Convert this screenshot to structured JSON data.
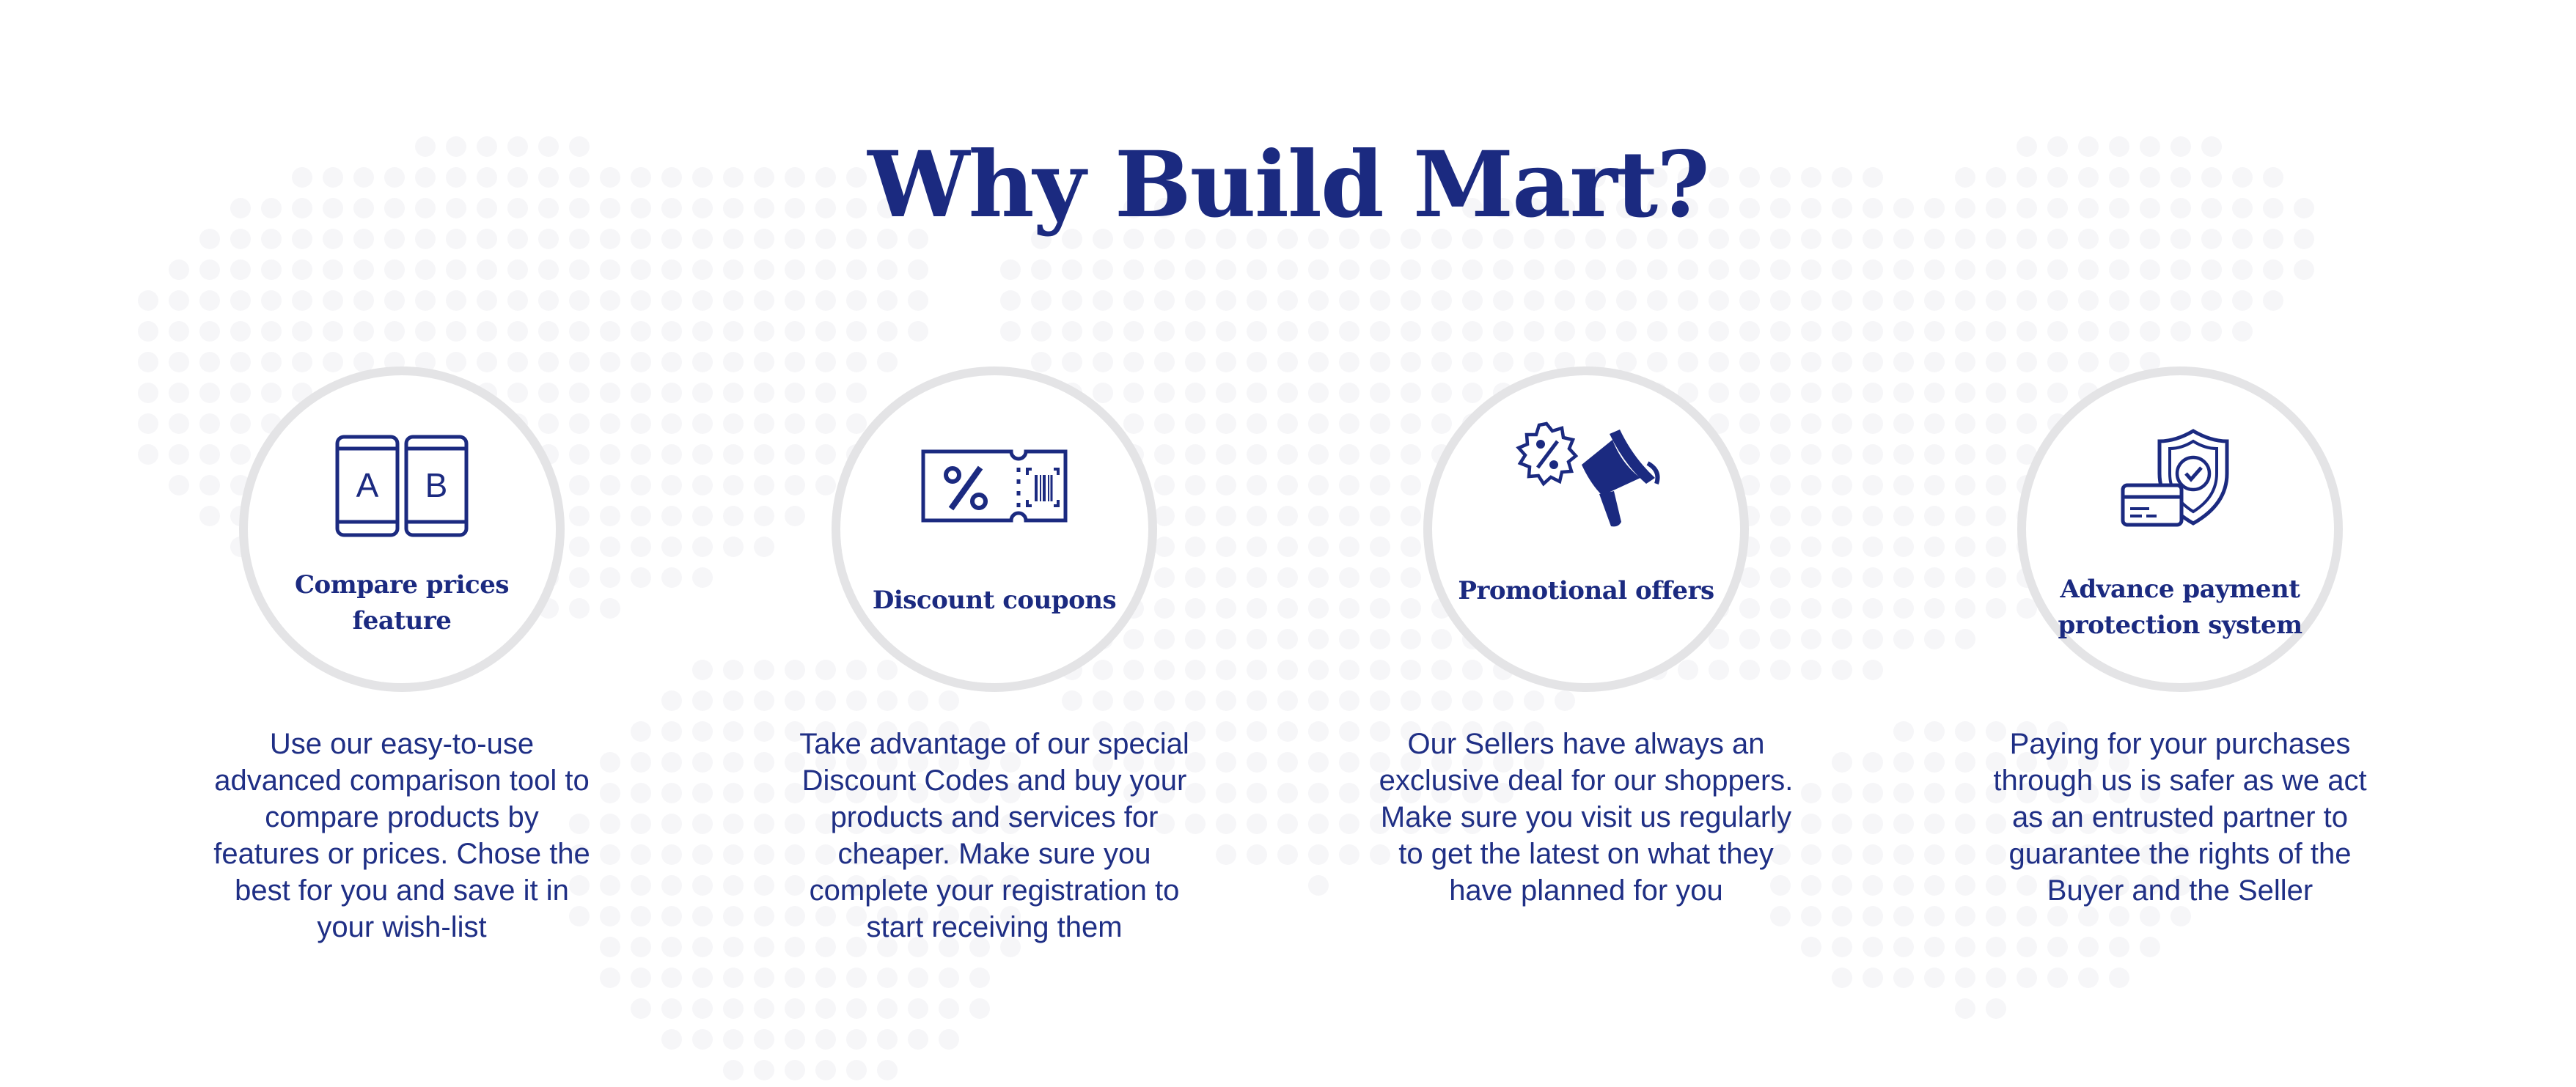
{
  "page": {
    "title": "Why Build Mart?",
    "colors": {
      "brand": "#1b2a80",
      "circle_border": "#e4e4e6",
      "text": "#1f2f85"
    }
  },
  "features": [
    {
      "icon": "ab-compare-phones-icon",
      "label_lines": [
        "Compare prices",
        "feature"
      ],
      "description_lines": [
        "Use our easy-to-use",
        "advanced comparison tool to",
        "compare products by",
        "features or prices. Chose the",
        "best for you and save it in",
        "your wish-list"
      ],
      "icon_letters": [
        "A",
        "B"
      ]
    },
    {
      "icon": "discount-coupon-icon",
      "label_lines": [
        "Discount coupons"
      ],
      "description_lines": [
        "Take advantage of  our special",
        "Discount Codes and buy your",
        "products and services for",
        "cheaper. Make sure you",
        "complete your registration to",
        "start receiving them"
      ]
    },
    {
      "icon": "megaphone-percent-icon",
      "label_lines": [
        "Promotional offers"
      ],
      "description_lines": [
        "Our Sellers have always an",
        "exclusive deal for our shoppers.",
        "Make sure you visit us regularly",
        "to get the latest on what they",
        "have planned for you"
      ]
    },
    {
      "icon": "shield-card-protection-icon",
      "label_lines": [
        "Advance payment",
        "protection system"
      ],
      "description_lines": [
        "Paying for your purchases",
        "through us is safer as we act",
        "as an entrusted partner to",
        "guarantee the rights of  the",
        "Buyer and the Seller"
      ]
    }
  ]
}
